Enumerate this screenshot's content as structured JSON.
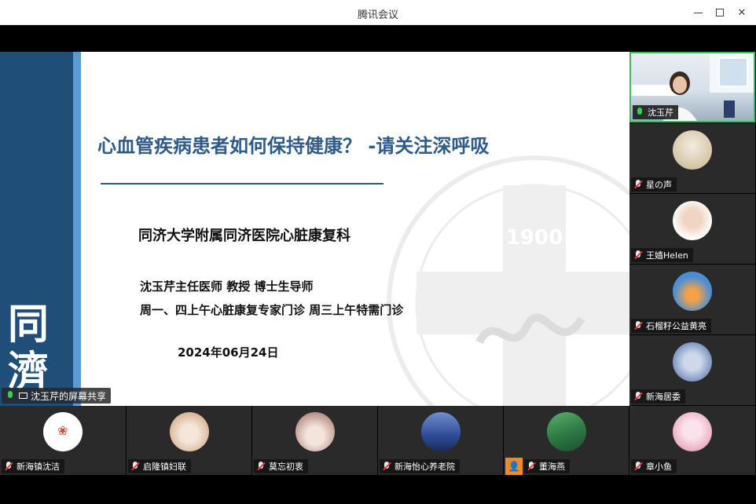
{
  "window": {
    "title": "腾讯会议"
  },
  "slide": {
    "calligraphy": "同濟",
    "title": "心血管疾病患者如何保持健康？ -请关注深呼吸",
    "department": "同济大学附属同济医院心脏康复科",
    "doctor": "沈玉芹主任医师 教授 博士生导师",
    "clinic_hours": "周一、四上午心脏康复专家门诊 周三上午特需门诊",
    "date": "2024年06月24日",
    "watermark_year": "1900"
  },
  "share_label": "沈玉芹的屏幕共享",
  "right_tiles": [
    {
      "name": "沈玉芹",
      "mic": "on",
      "type": "video"
    },
    {
      "name": "星の声",
      "mic": "off",
      "type": "avatar",
      "color": "#d9c9a8"
    },
    {
      "name": "王嫱Helen",
      "mic": "off",
      "type": "avatar",
      "color": "#f3e1d6"
    },
    {
      "name": "石榴籽公益黄亮",
      "mic": "off",
      "type": "avatar",
      "color": "#4a8fd6"
    },
    {
      "name": "新海居委",
      "mic": "off",
      "type": "avatar",
      "color": "#9bb2d6"
    }
  ],
  "bottom_tiles": [
    {
      "name": "新海镇沈洁",
      "mic": "off",
      "color": "#ffffff"
    },
    {
      "name": "启隆镇妇联",
      "mic": "off",
      "color": "#e8cdb4"
    },
    {
      "name": "莫忘初衷",
      "mic": "off",
      "color": "#d8b8b0"
    },
    {
      "name": "新海怡心养老院",
      "mic": "off",
      "color": "#3b5fa8"
    },
    {
      "name": "董海燕",
      "mic": "off",
      "color": "#3d8f5a",
      "badge": true
    },
    {
      "name": "章小鱼",
      "mic": "off",
      "color": "#f2c8d8"
    }
  ],
  "colors": {
    "accent": "#2fc35c",
    "slide_title": "#2e5b8a",
    "mic_off": "#e03b3b"
  }
}
